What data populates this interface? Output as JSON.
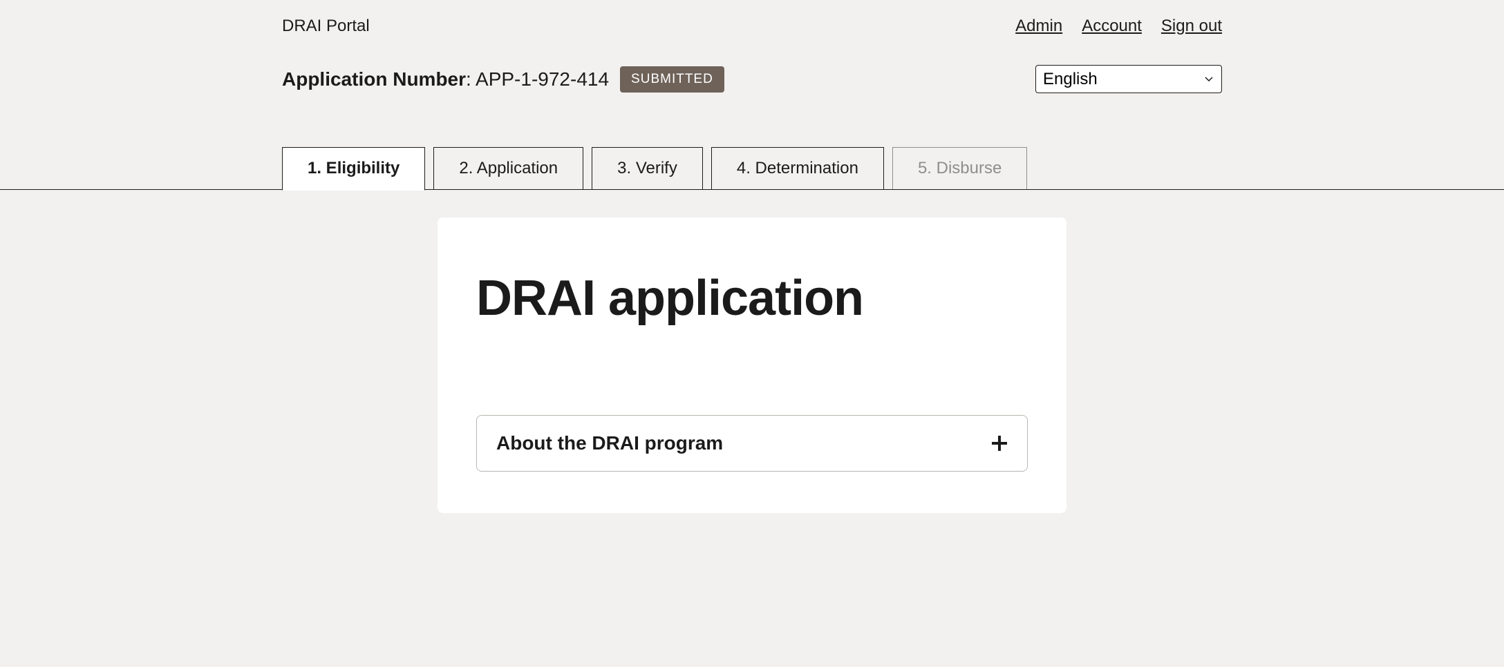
{
  "header": {
    "portal_name": "DRAI Portal",
    "links": {
      "admin": "Admin",
      "account": "Account",
      "signout": "Sign out"
    }
  },
  "application": {
    "label": "Application Number",
    "value": "APP-1-972-414",
    "status": "SUBMITTED"
  },
  "language": {
    "selected": "English"
  },
  "tabs": [
    {
      "label": "1. Eligibility",
      "active": true,
      "disabled": false
    },
    {
      "label": "2. Application",
      "active": false,
      "disabled": false
    },
    {
      "label": "3. Verify",
      "active": false,
      "disabled": false
    },
    {
      "label": "4. Determination",
      "active": false,
      "disabled": false
    },
    {
      "label": "5. Disburse",
      "active": false,
      "disabled": true
    }
  ],
  "main": {
    "title": "DRAI application",
    "accordion": {
      "title": "About the DRAI program"
    }
  }
}
